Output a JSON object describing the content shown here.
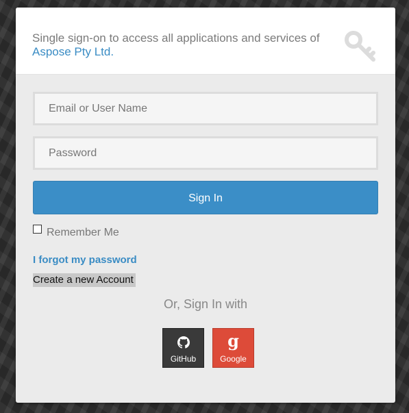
{
  "header": {
    "intro_prefix": "Single sign-on to access all applications and services of ",
    "org_name": "Aspose Pty Ltd",
    "intro_suffix": ".",
    "icon": "key-icon"
  },
  "form": {
    "email_placeholder": "Email or User Name",
    "email_value": "",
    "password_placeholder": "Password",
    "password_value": "",
    "signin_label": "Sign In",
    "remember_label": "Remember Me",
    "remember_checked": false,
    "forgot_label": "I forgot my password",
    "create_label": "Create a new Account"
  },
  "social": {
    "heading": "Or, Sign In with",
    "providers": [
      {
        "label": "GitHub",
        "icon": "github-icon",
        "color": "#3a3a3a"
      },
      {
        "label": "Google",
        "icon": "google-icon",
        "color": "#dd4b39",
        "glyph": "g"
      }
    ]
  },
  "colors": {
    "accent": "#3b8ec7",
    "link": "#3a8cc4"
  }
}
